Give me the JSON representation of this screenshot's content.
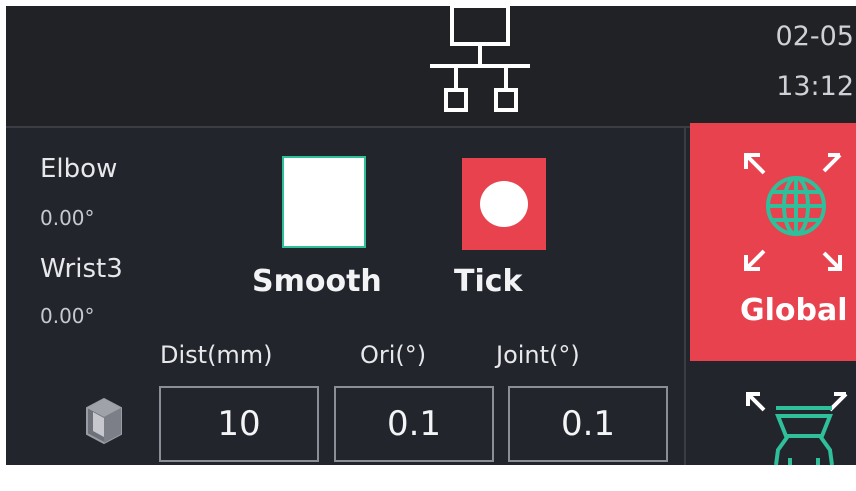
{
  "header": {
    "date": "02-05",
    "time": "13:12",
    "network_icon": "network-icon"
  },
  "joints": [
    {
      "name": "Elbow",
      "value": "0.00°"
    },
    {
      "name": "Wrist3",
      "value": "0.00°"
    }
  ],
  "modes": {
    "smooth_label": "Smooth",
    "tick_label": "Tick"
  },
  "step_fields": {
    "dist_label": "Dist(mm)",
    "dist_value": "10",
    "ori_label": "Ori(°)",
    "ori_value": "0.1",
    "joint_label": "Joint(°)",
    "joint_value": "0.1"
  },
  "coordinate": {
    "global_label": "Global",
    "global_icon": "globe-icon",
    "tool_icon": "robot-tool-icon"
  },
  "colors": {
    "accent_red": "#e8424e",
    "accent_teal": "#2fbf9a",
    "background": "#23252c"
  }
}
